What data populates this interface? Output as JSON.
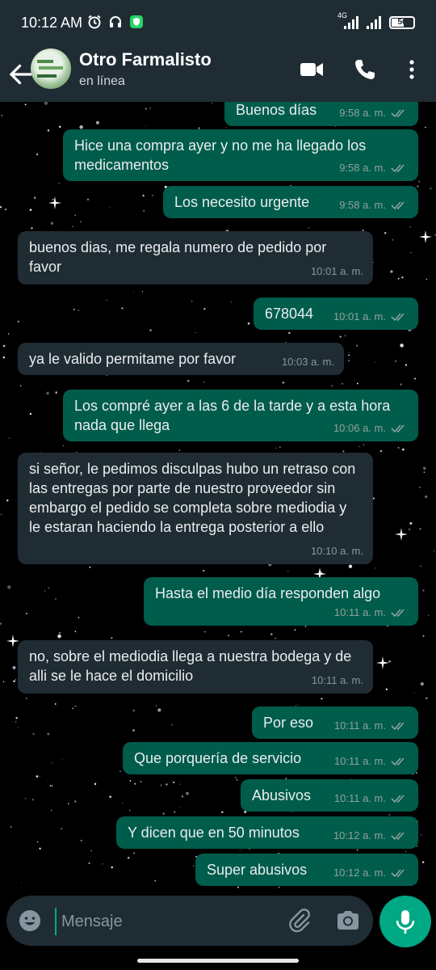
{
  "status_bar": {
    "time": "10:12 AM",
    "network": "4G",
    "battery": "56",
    "battery_level": 0.56
  },
  "header": {
    "contact_name": "Otro Farmalisto",
    "presence": "en línea"
  },
  "messages": [
    {
      "dir": "out",
      "text": "Buenos días",
      "time": "9:58 a. m.",
      "ticks": "read"
    },
    {
      "dir": "out",
      "text": "Hice una compra ayer y no me ha llegado los medicamentos",
      "time": "9:58 a. m.",
      "ticks": "read"
    },
    {
      "dir": "out",
      "text": "Los necesito urgente",
      "time": "9:58 a. m.",
      "ticks": "read"
    },
    {
      "dir": "in",
      "text": "buenos dias, me regala numero de pedido por favor",
      "time": "10:01 a. m."
    },
    {
      "dir": "out",
      "text": "678044",
      "time": "10:01 a. m.",
      "ticks": "read"
    },
    {
      "dir": "in",
      "text": "ya le valido permitame por favor",
      "time": "10:03 a. m."
    },
    {
      "dir": "out",
      "text": "Los compré ayer a las 6 de la tarde y a esta hora nada que llega",
      "time": "10:06 a. m.",
      "ticks": "read"
    },
    {
      "dir": "in",
      "text": "si señor, le pedimos disculpas hubo un retraso con las entregas por parte de nuestro proveedor sin embargo el pedido se completa sobre mediodia y le estaran haciendo la entrega posterior a ello",
      "time": "10:10 a. m."
    },
    {
      "dir": "out",
      "text": "Hasta el medio día responden algo",
      "time": "10:11 a. m.",
      "ticks": "read"
    },
    {
      "dir": "in",
      "text": "no, sobre el mediodia llega a nuestra bodega y de alli se le hace el domicilio",
      "time": "10:11 a. m."
    },
    {
      "dir": "out",
      "text": "Por eso",
      "time": "10:11 a. m.",
      "ticks": "read"
    },
    {
      "dir": "out",
      "text": "Que porquería de servicio",
      "time": "10:11 a. m.",
      "ticks": "read"
    },
    {
      "dir": "out",
      "text": "Abusivos",
      "time": "10:11 a. m.",
      "ticks": "read"
    },
    {
      "dir": "out",
      "text": "Y dicen que en 50 minutos",
      "time": "10:12 a. m.",
      "ticks": "read"
    },
    {
      "dir": "out",
      "text": "Super abusivos",
      "time": "10:12 a. m.",
      "ticks": "read"
    }
  ],
  "composer": {
    "placeholder": "Mensaje"
  },
  "colors": {
    "outgoing_bubble": "#005c4b",
    "incoming_bubble": "#202c33",
    "header_bg": "#1f2c34",
    "accent": "#00a884",
    "read_ticks": "#8fa39c"
  },
  "icons": [
    "alarm-icon",
    "headset-icon",
    "shield-icon",
    "back-arrow-icon",
    "video-call-icon",
    "phone-icon",
    "more-vert-icon",
    "emoji-icon",
    "attach-icon",
    "camera-icon",
    "mic-icon"
  ]
}
